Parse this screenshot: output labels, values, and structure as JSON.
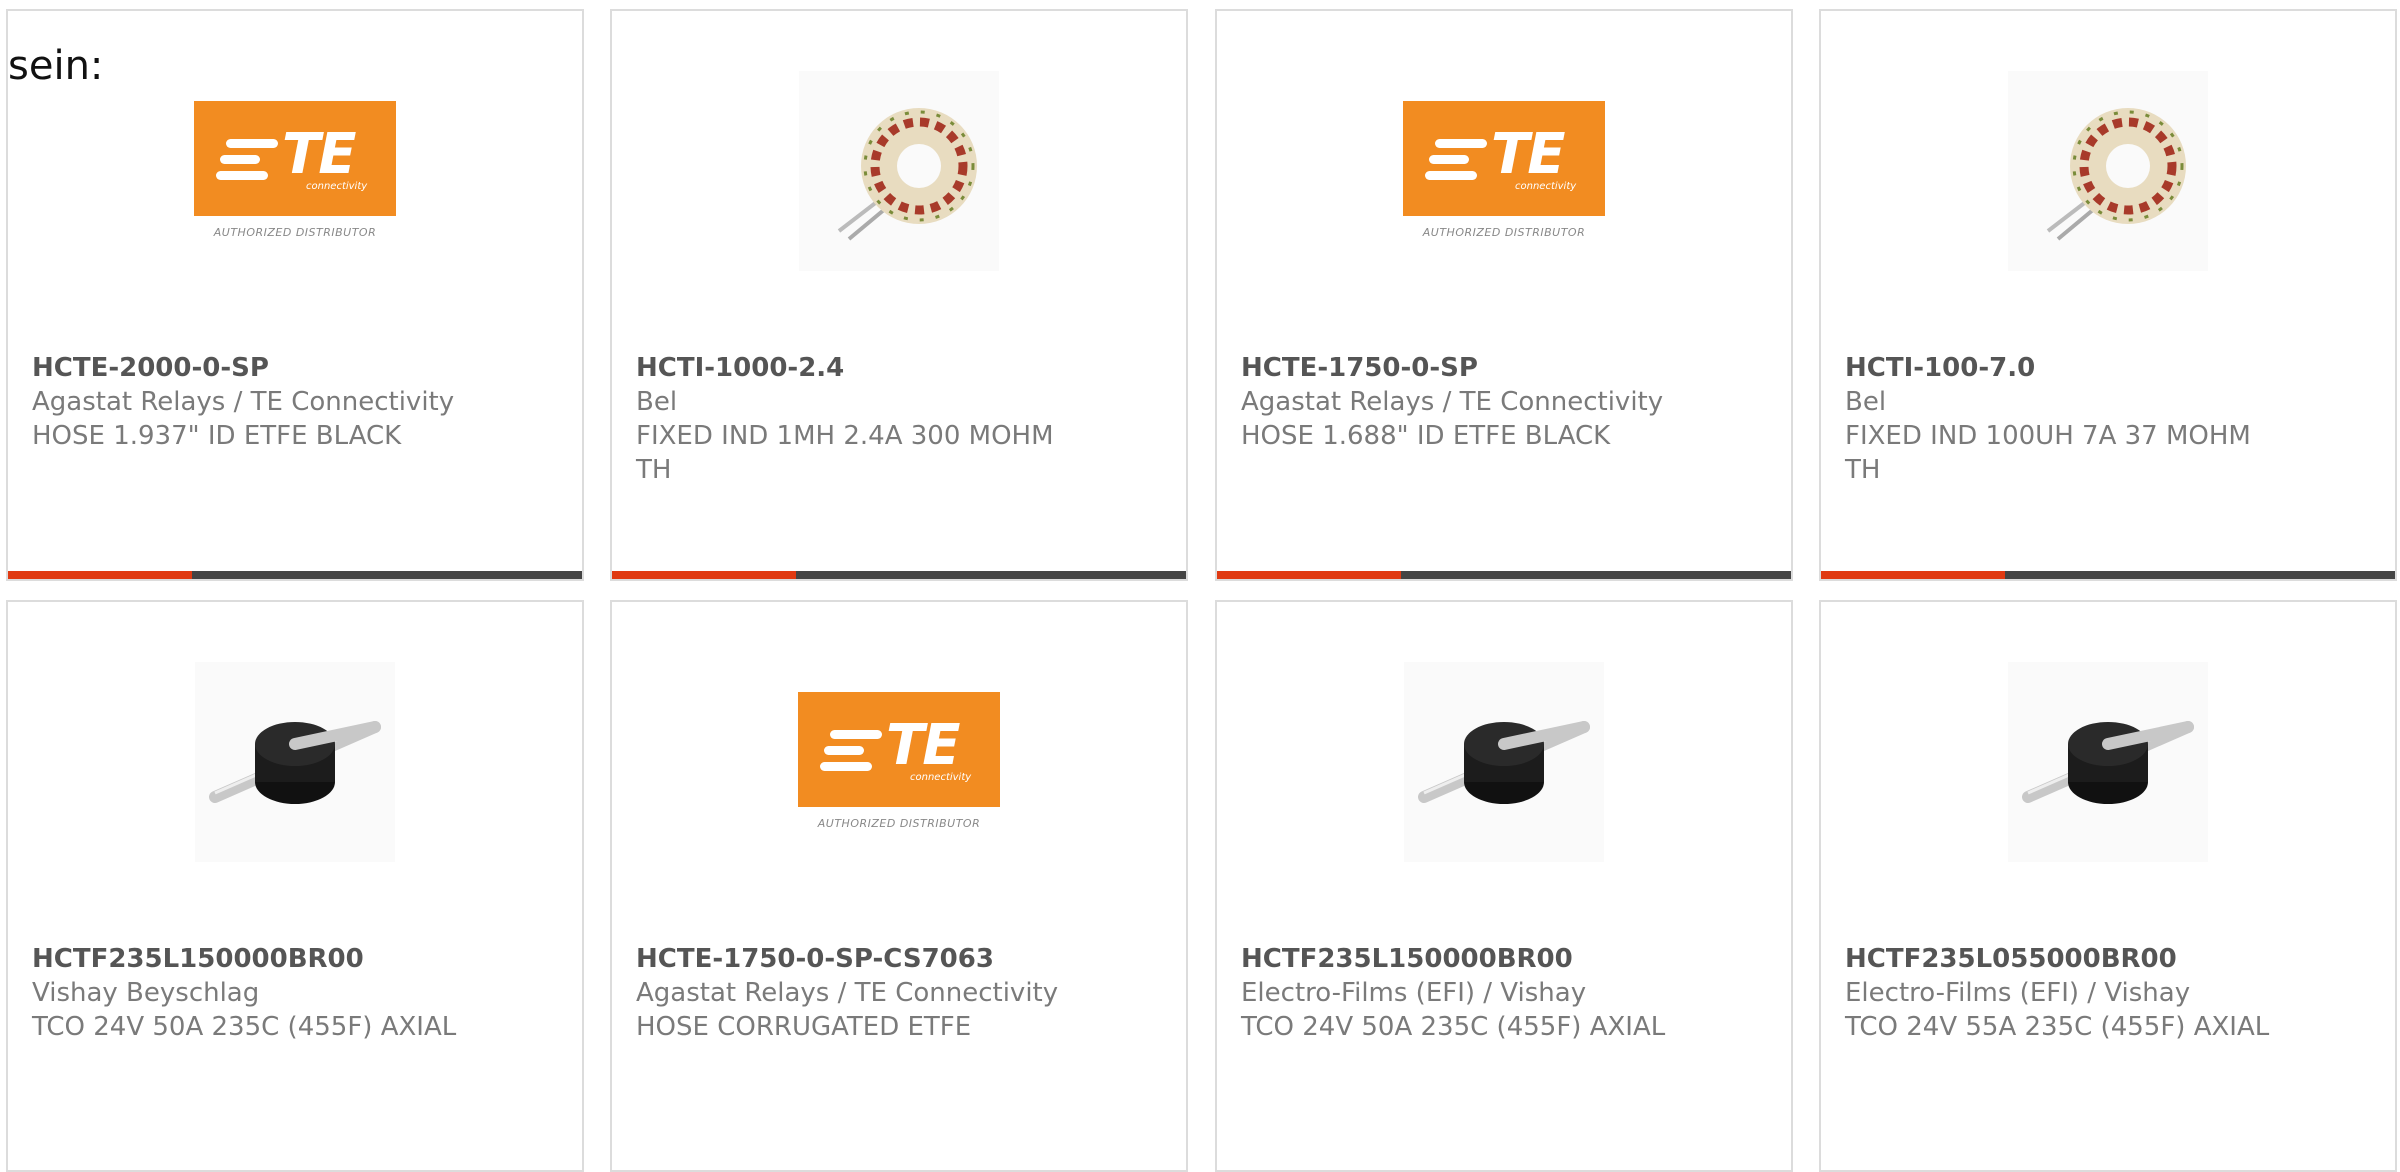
{
  "intro_text": "sein:",
  "accent_color": "#e03a12",
  "bar_color": "#444444",
  "logo": {
    "brand": "TE",
    "sub": "connectivity",
    "caption": "AUTHORIZED DISTRIBUTOR"
  },
  "products": [
    {
      "part_number": "HCTE-2000-0-SP",
      "manufacturer": "Agastat Relays / TE Connectivity",
      "description": "HOSE 1.937\" ID ETFE BLACK",
      "image": "te-logo"
    },
    {
      "part_number": "HCTI-1000-2.4",
      "manufacturer": "Bel",
      "description": "FIXED IND 1MH 2.4A 300 MOHM TH",
      "image": "toroid-inductor-photo"
    },
    {
      "part_number": "HCTE-1750-0-SP",
      "manufacturer": "Agastat Relays / TE Connectivity",
      "description": "HOSE 1.688\" ID ETFE BLACK",
      "image": "te-logo"
    },
    {
      "part_number": "HCTI-100-7.0",
      "manufacturer": "Bel",
      "description": "FIXED IND 100UH 7A 37 MOHM TH",
      "image": "toroid-inductor-photo"
    },
    {
      "part_number": "HCTF235L150000BR00",
      "manufacturer": "Vishay Beyschlag",
      "description": "TCO 24V 50A 235C (455F) AXIAL",
      "image": "axial-cutoff-photo"
    },
    {
      "part_number": "HCTE-1750-0-SP-CS7063",
      "manufacturer": "Agastat Relays / TE Connectivity",
      "description": "HOSE CORRUGATED ETFE",
      "image": "te-logo"
    },
    {
      "part_number": "HCTF235L150000BR00",
      "manufacturer": "Electro-Films (EFI) / Vishay",
      "description": "TCO 24V 50A 235C (455F) AXIAL",
      "image": "axial-cutoff-photo"
    },
    {
      "part_number": "HCTF235L055000BR00",
      "manufacturer": "Electro-Films (EFI) / Vishay",
      "description": "TCO 24V 55A 235C (455F) AXIAL",
      "image": "axial-cutoff-photo"
    }
  ]
}
